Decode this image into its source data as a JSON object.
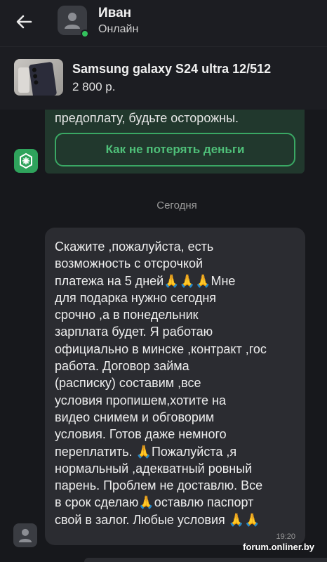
{
  "header": {
    "contact_name": "Иван",
    "contact_status": "Онлайн",
    "status_color": "#33c15d"
  },
  "product": {
    "title": "Samsung galaxy S24 ultra 12/512",
    "price": "2 800 р."
  },
  "system_message": {
    "text": "предоплату, будьте осторожны.",
    "button_label": "Как не потерять деньги",
    "accent_color": "#3aa864"
  },
  "date_separator": "Сегодня",
  "message": {
    "text": "Скажите ,пожалуйста, есть\nвозможность с отсрочкой\nплатежа на 5 дней🙏🙏🙏Мне\nдля подарка   нужно сегодня\nсрочно   ,а в понедельник\nзарплата  будет.  Я работаю\nофициально в минске ,контракт ,гос\nработа. Договор займа\n(расписку) составим ,все\nусловия пропишем,хотите на\nвидео снимем и обговорим\nусловия.  Готов даже немного\nпереплатить. 🙏Пожалуйста ,я\nнормальный ,адекватный ровный\nпарень.  Проблем не доставлю.  Все\nв срок сделаю🙏оставлю паспорт\nсвой  в залог. Любые условия 🙏🙏",
    "time": "19:20"
  },
  "watermark": "forum.onliner.by"
}
